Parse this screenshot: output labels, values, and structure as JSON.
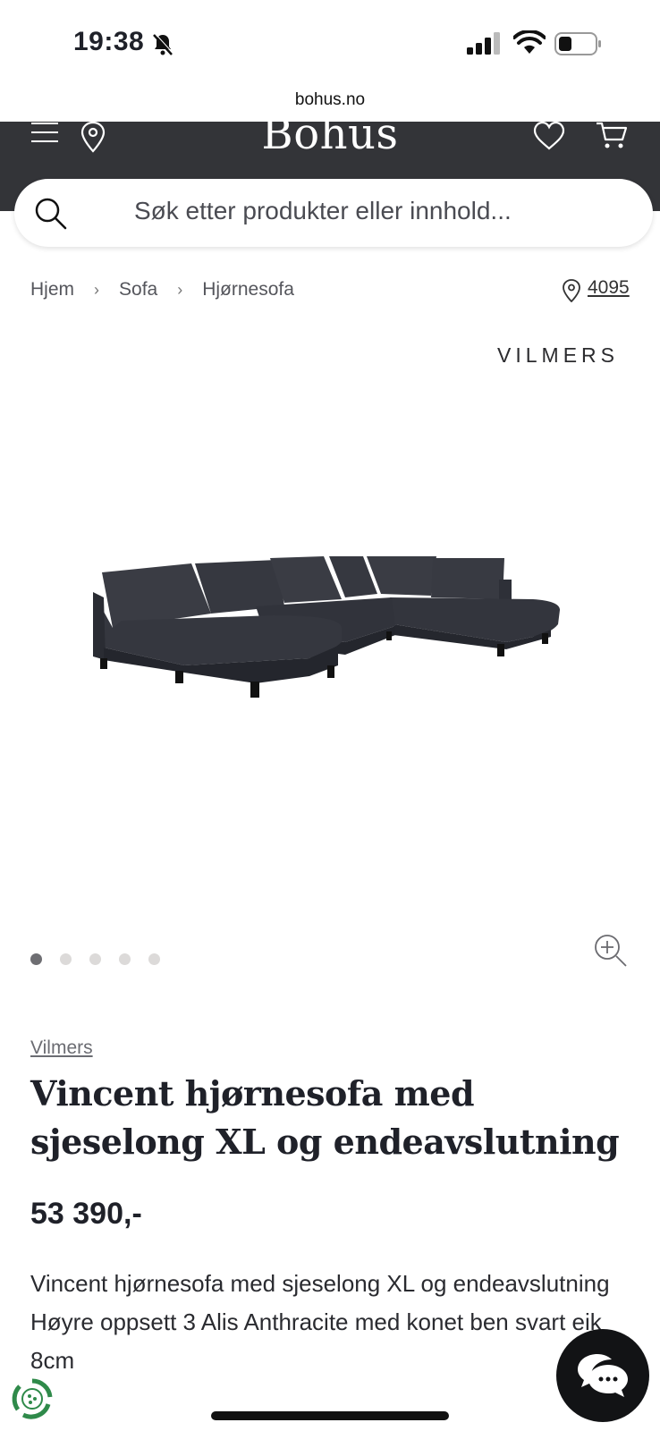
{
  "status_bar": {
    "time": "19:38"
  },
  "browser": {
    "url": "bohus.no"
  },
  "header": {
    "logo": "Bohus"
  },
  "search": {
    "placeholder": "Søk etter produkter eller innhold..."
  },
  "breadcrumb": [
    {
      "label": "Hjem"
    },
    {
      "label": "Sofa"
    },
    {
      "label": "Hjørnesofa"
    }
  ],
  "store": {
    "code": "4095"
  },
  "gallery": {
    "brand_mark": "VILMERS",
    "image_count": 5,
    "active_index": 0
  },
  "product": {
    "brand": "Vilmers",
    "title": "Vincent hjørnesofa med sjeselong XL og endeavslutning",
    "price": "53 390,-",
    "description": "Vincent hjørnesofa med sjeselong XL og endeavslutning Høyre oppsett 3 Alis Anthracite med konet ben svart eik 8cm"
  },
  "colors": {
    "header_bg": "#333438",
    "gallery_bg": "#f4f2f1",
    "text": "#1f2129"
  },
  "icons": [
    "bell-off-icon",
    "signal-icon",
    "wifi-icon",
    "battery-icon",
    "menu-icon",
    "location-pin-icon",
    "heart-icon",
    "cart-icon",
    "search-icon",
    "zoom-icon",
    "chat-icon",
    "eco-icon"
  ]
}
